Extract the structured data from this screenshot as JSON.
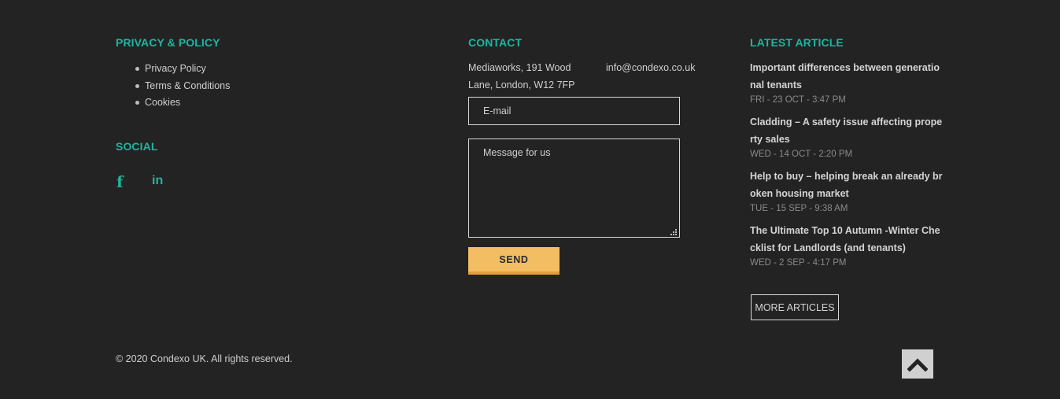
{
  "privacy": {
    "heading": "PRIVACY & POLICY",
    "links": [
      "Privacy Policy",
      "Terms & Conditions",
      "Cookies"
    ]
  },
  "social": {
    "heading": "SOCIAL",
    "icons": [
      "facebook-icon",
      "linkedin-icon"
    ],
    "facebook_glyph": "f",
    "linkedin_glyph": "in"
  },
  "contact": {
    "heading": "CONTACT",
    "address_line1": "Mediaworks, 191 Wood",
    "address_line2": "Lane, London, W12 7FP",
    "email": "info@condexo.co.uk",
    "email_placeholder": "E-mail",
    "message_placeholder": "Message for us",
    "send_label": "SEND"
  },
  "articles": {
    "heading": "LATEST ARTICLE",
    "items": [
      {
        "title": "Important differences between generational tenants",
        "date": "FRI - 23 OCT - 3:47 PM"
      },
      {
        "title": "Cladding – A safety issue affecting property sales",
        "date": "WED - 14 OCT - 2:20 PM"
      },
      {
        "title": "Help to buy – helping break an already broken housing market",
        "date": "TUE - 15 SEP - 9:38 AM"
      },
      {
        "title": "The Ultimate Top 10 Autumn -Winter Checklist for Landlords (and tenants)",
        "date": "WED - 2 SEP - 4:17 PM"
      }
    ],
    "more_label": "MORE ARTICLES"
  },
  "footer": {
    "copyright": "© 2020 Condexo UK. All rights reserved."
  },
  "colors": {
    "background": "#232323",
    "accent": "#1fb5a0",
    "button": "#f3bd63"
  }
}
